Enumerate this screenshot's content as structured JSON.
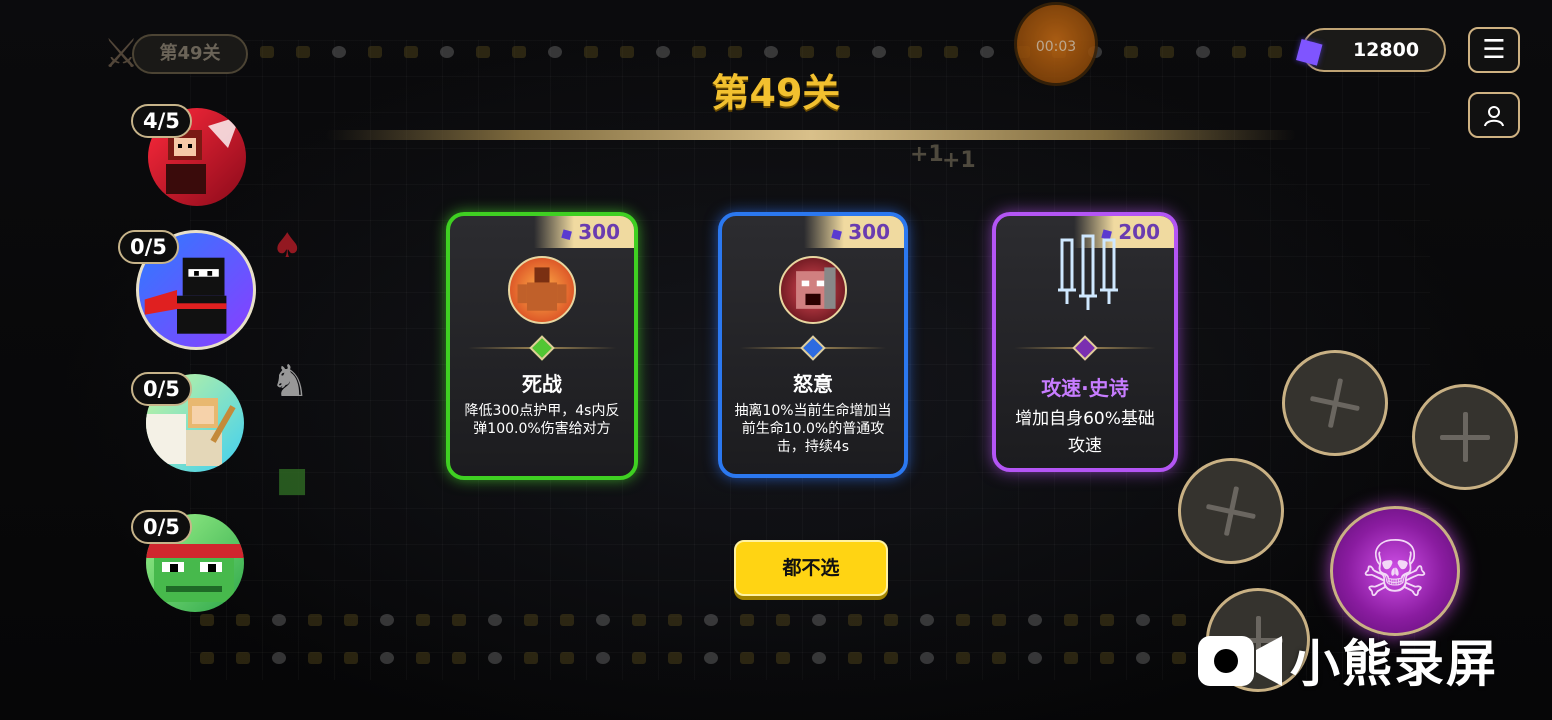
{
  "level_badge": {
    "label": "第49关"
  },
  "timer": {
    "text": "00:03"
  },
  "currency": {
    "amount": "12800",
    "icon": "gem-icon",
    "color": "#7f55ff"
  },
  "top_buttons": {
    "menu_icon": "menu-icon",
    "profile_icon": "profile-icon"
  },
  "stage_title": "第49关",
  "floating_texts": [
    "+1",
    "+1"
  ],
  "heroes": [
    {
      "name": "red-hood-hero",
      "count": "4/5",
      "colors": [
        "#ff2a3c",
        "#8a0a1a"
      ]
    },
    {
      "name": "ninja-hero",
      "count": "0/5",
      "colors": [
        "#2d7cff",
        "#8c3cff"
      ]
    },
    {
      "name": "angel-hero",
      "count": "0/5",
      "colors": [
        "#b9f59a",
        "#4fd2f2"
      ]
    },
    {
      "name": "frog-hero",
      "count": "0/5",
      "colors": [
        "#9cf28a",
        "#2da74a"
      ]
    }
  ],
  "cards": [
    {
      "rarity_color": "#3fd022",
      "cost": "300",
      "name": "死战",
      "description": "降低300点护甲，4s内反弹100.0%伤害给对方",
      "icon": "muscle-man-icon"
    },
    {
      "rarity_color": "#2b78f0",
      "cost": "300",
      "name": "怒意",
      "description": "抽离10%当前生命增加当前生命10.0%的普通攻击，持续4s",
      "icon": "rage-face-icon"
    },
    {
      "rarity_color": "#b455f5",
      "cost": "200",
      "name": "攻速·史诗",
      "description": "增加自身60%基础攻速",
      "icon": "triple-sword-icon"
    }
  ],
  "skip_button": {
    "label": "都不选"
  },
  "skill_slots": [
    "empty-slot",
    "empty-slot",
    "empty-slot",
    "empty-slot"
  ],
  "ultimate": {
    "icon": "skull-icon"
  },
  "watermark": {
    "text": "小熊录屏",
    "icon": "video-camera-icon"
  }
}
